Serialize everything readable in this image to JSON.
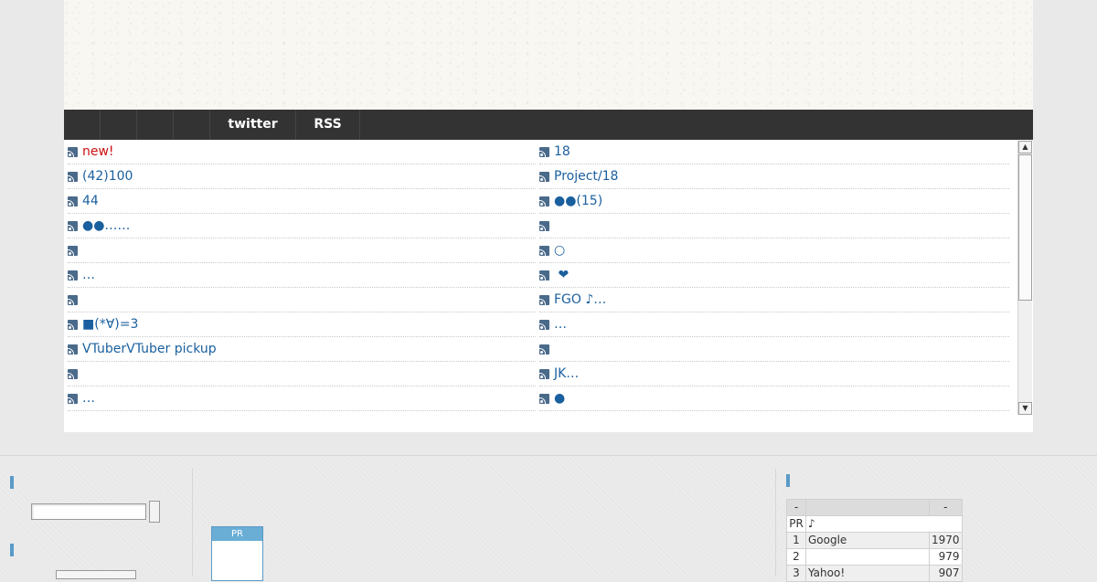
{
  "nav": {
    "items": [
      "",
      "",
      "",
      "",
      "twitter",
      "RSS"
    ]
  },
  "feed": {
    "left": [
      {
        "text": "new!",
        "new": true
      },
      {
        "text": "(42)100"
      },
      {
        "text": "44"
      },
      {
        "text": "●●……"
      },
      {
        "text": ""
      },
      {
        "text": "…"
      },
      {
        "text": ""
      },
      {
        "text": "■(*∀)=3"
      },
      {
        "text": "VTuberVTuber pickup"
      },
      {
        "text": ""
      },
      {
        "text": "…"
      }
    ],
    "right": [
      {
        "text": "18"
      },
      {
        "text": "Project/18"
      },
      {
        "text": "●●(15)"
      },
      {
        "text": ""
      },
      {
        "text": "○"
      },
      {
        "text": " ❤"
      },
      {
        "text": "FGO ♪…"
      },
      {
        "text": "…"
      },
      {
        "text": ""
      },
      {
        "text": "JK…"
      },
      {
        "text": "●"
      }
    ],
    "scroll_up": "▲",
    "scroll_down": "▼"
  },
  "footer": {
    "search": {
      "value": "",
      "placeholder": ""
    },
    "pr_label": "PR",
    "ranking": {
      "header": [
        "-",
        "",
        "-"
      ],
      "pr_row": [
        "PR",
        "♪"
      ],
      "rows": [
        {
          "rank": "1",
          "name": "Google",
          "count": "1970"
        },
        {
          "rank": "2",
          "name": "",
          "count": "979"
        },
        {
          "rank": "3",
          "name": "Yahoo!",
          "count": "907"
        }
      ]
    }
  },
  "colors": {
    "nav_bg": "#333333",
    "link": "#1a5f9e",
    "new_link": "#cc1111",
    "accent": "#5a9ac8"
  }
}
